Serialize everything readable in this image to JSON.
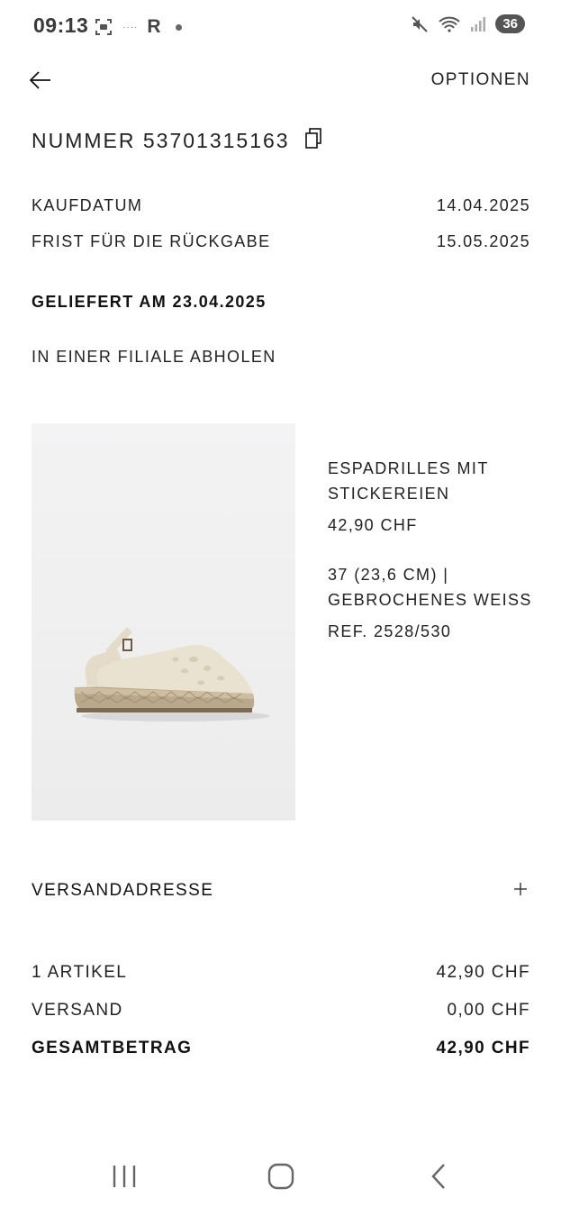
{
  "status_bar": {
    "time": "09:13",
    "carrier_mark": "R",
    "battery": "36"
  },
  "header": {
    "options_label": "OPTIONEN"
  },
  "order": {
    "number_label": "NUMMER 53701315163",
    "purchase_date_label": "KAUFDATUM",
    "purchase_date": "14.04.2025",
    "return_deadline_label": "FRIST FÜR DIE RÜCKGABE",
    "return_deadline": "15.05.2025",
    "delivered_label": "GELIEFERT AM 23.04.2025",
    "pickup_label": "IN EINER FILIALE ABHOLEN"
  },
  "product": {
    "name_line1": "ESPADRILLES MIT",
    "name_line2": "STICKEREIEN",
    "price": "42,90 CHF",
    "variant_line1": "37 (23,6 CM) |",
    "variant_line2": "GEBROCHENES WEISS",
    "reference": "REF. 2528/530"
  },
  "shipping_address": {
    "label": "VERSANDADRESSE",
    "expand_glyph": "+"
  },
  "summary": {
    "items_label": "1 ARTIKEL",
    "items_value": "42,90 CHF",
    "shipping_label": "VERSAND",
    "shipping_value": "0,00 CHF",
    "total_label": "GESAMTBETRAG",
    "total_value": "42,90 CHF"
  },
  "icons": [
    "back-arrow-icon",
    "copy-icon",
    "plus-icon",
    "recent-apps-icon",
    "home-icon",
    "nav-back-icon"
  ]
}
